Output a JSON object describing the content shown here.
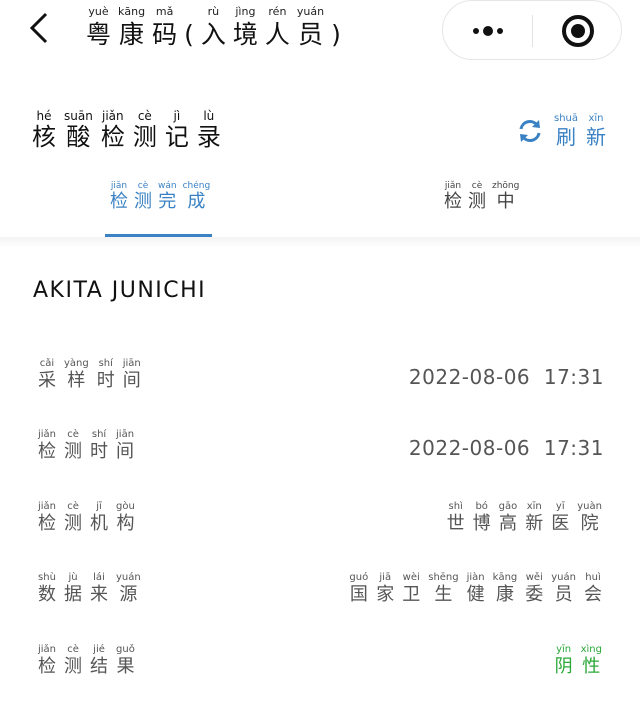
{
  "nav": {
    "title": [
      {
        "py": "yuè",
        "hz": "粤"
      },
      {
        "py": "kāng",
        "hz": "康"
      },
      {
        "py": "mǎ",
        "hz": "码"
      },
      {
        "paren": "("
      },
      {
        "py": "rù",
        "hz": "入"
      },
      {
        "py": "jìng",
        "hz": "境"
      },
      {
        "py": "rén",
        "hz": "人"
      },
      {
        "py": "yuán",
        "hz": "员"
      },
      {
        "paren": ")"
      }
    ],
    "icons": {
      "back": "chevron-left-icon",
      "more": "more-dots-icon",
      "close": "target-close-icon"
    }
  },
  "section": {
    "title": [
      {
        "py": "hé",
        "hz": "核"
      },
      {
        "py": "suān",
        "hz": "酸"
      },
      {
        "py": "jiǎn",
        "hz": "检"
      },
      {
        "py": "cè",
        "hz": "测"
      },
      {
        "py": "jì",
        "hz": "记"
      },
      {
        "py": "lù",
        "hz": "录"
      }
    ],
    "refresh": [
      {
        "py": "shuā",
        "hz": "刷"
      },
      {
        "py": "xīn",
        "hz": "新"
      }
    ]
  },
  "tabs": [
    {
      "active": true,
      "chars": [
        {
          "py": "jiǎn",
          "hz": "检"
        },
        {
          "py": "cè",
          "hz": "测"
        },
        {
          "py": "wán",
          "hz": "完"
        },
        {
          "py": "chéng",
          "hz": "成"
        }
      ]
    },
    {
      "active": false,
      "chars": [
        {
          "py": "jiǎn",
          "hz": "检"
        },
        {
          "py": "cè",
          "hz": "测"
        },
        {
          "py": "zhōng",
          "hz": "中"
        }
      ]
    }
  ],
  "record": {
    "name": "AKITA JUNICHI",
    "rows": [
      {
        "label": [
          {
            "py": "cǎi",
            "hz": "采"
          },
          {
            "py": "yàng",
            "hz": "样"
          },
          {
            "py": "shí",
            "hz": "时"
          },
          {
            "py": "jiān",
            "hz": "间"
          }
        ],
        "value": "2022-08-06  17:31"
      },
      {
        "label": [
          {
            "py": "jiǎn",
            "hz": "检"
          },
          {
            "py": "cè",
            "hz": "测"
          },
          {
            "py": "shí",
            "hz": "时"
          },
          {
            "py": "jiān",
            "hz": "间"
          }
        ],
        "value": "2022-08-06  17:31"
      },
      {
        "label": [
          {
            "py": "jiǎn",
            "hz": "检"
          },
          {
            "py": "cè",
            "hz": "测"
          },
          {
            "py": "jī",
            "hz": "机"
          },
          {
            "py": "gòu",
            "hz": "构"
          }
        ],
        "value_ruby": [
          {
            "py": "shì",
            "hz": "世"
          },
          {
            "py": "bó",
            "hz": "博"
          },
          {
            "py": "gāo",
            "hz": "高"
          },
          {
            "py": "xīn",
            "hz": "新"
          },
          {
            "py": "yī",
            "hz": "医"
          },
          {
            "py": "yuàn",
            "hz": "院"
          }
        ]
      },
      {
        "label": [
          {
            "py": "shù",
            "hz": "数"
          },
          {
            "py": "jù",
            "hz": "据"
          },
          {
            "py": "lái",
            "hz": "来"
          },
          {
            "py": "yuán",
            "hz": "源"
          }
        ],
        "value_ruby": [
          {
            "py": "guó",
            "hz": "国"
          },
          {
            "py": "jiā",
            "hz": "家"
          },
          {
            "py": "wèi",
            "hz": "卫"
          },
          {
            "py": "shēng",
            "hz": "生"
          },
          {
            "py": "jiàn",
            "hz": "健"
          },
          {
            "py": "kāng",
            "hz": "康"
          },
          {
            "py": "wěi",
            "hz": "委"
          },
          {
            "py": "yuán",
            "hz": "员"
          },
          {
            "py": "huì",
            "hz": "会"
          }
        ]
      },
      {
        "label": [
          {
            "py": "jiǎn",
            "hz": "检"
          },
          {
            "py": "cè",
            "hz": "测"
          },
          {
            "py": "jié",
            "hz": "结"
          },
          {
            "py": "guǒ",
            "hz": "果"
          }
        ],
        "value_ruby": [
          {
            "py": "yīn",
            "hz": "阴"
          },
          {
            "py": "xìng",
            "hz": "性"
          }
        ],
        "value_color": "#2aa838"
      }
    ]
  },
  "colors": {
    "accent": "#3a82c4",
    "negative": "#2aa838",
    "text": "#111111",
    "muted": "#555555"
  }
}
